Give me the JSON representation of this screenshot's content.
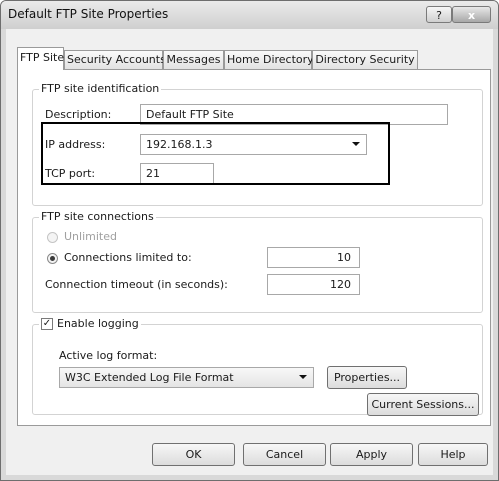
{
  "window": {
    "title": "Default FTP Site Properties",
    "help_label": "?",
    "close_label": "x"
  },
  "tabs": [
    {
      "label": "FTP Site",
      "active": true
    },
    {
      "label": "Security Accounts",
      "active": false
    },
    {
      "label": "Messages",
      "active": false
    },
    {
      "label": "Home Directory",
      "active": false
    },
    {
      "label": "Directory Security",
      "active": false
    }
  ],
  "identification": {
    "legend": "FTP site identification",
    "description_label": "Description:",
    "description_value": "Default FTP Site",
    "ip_label": "IP address:",
    "ip_value": "192.168.1.3",
    "port_label": "TCP port:",
    "port_value": "21"
  },
  "connections": {
    "legend": "FTP site connections",
    "unlimited_label": "Unlimited",
    "limited_label": "Connections limited to:",
    "limited_value": "10",
    "timeout_label": "Connection timeout (in seconds):",
    "timeout_value": "120",
    "selected": "limited"
  },
  "logging": {
    "enable_label": "Enable logging",
    "enabled": true,
    "format_label": "Active log format:",
    "format_value": "W3C Extended Log File Format",
    "properties_label": "Properties..."
  },
  "current_sessions_label": "Current Sessions...",
  "buttons": {
    "ok": "OK",
    "cancel": "Cancel",
    "apply": "Apply",
    "help": "Help"
  }
}
